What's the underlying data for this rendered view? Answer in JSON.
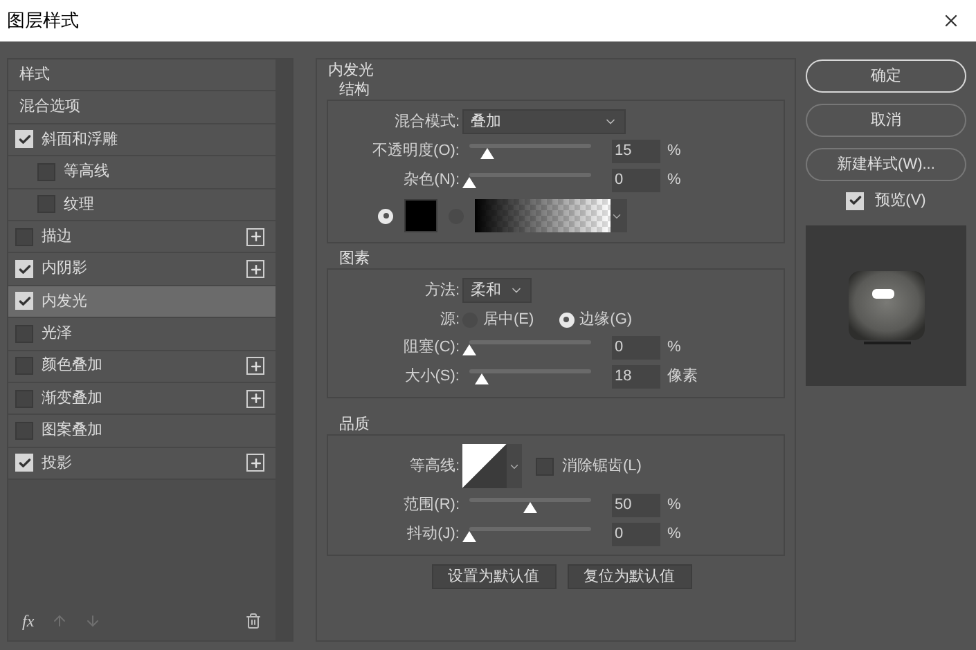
{
  "window": {
    "title": "图层样式"
  },
  "styles_panel": {
    "header": "样式",
    "items": [
      {
        "label": "混合选项",
        "kind": "plain",
        "selected": false
      },
      {
        "label": "斜面和浮雕",
        "kind": "check",
        "checked": true,
        "selected": false,
        "children": [
          {
            "label": "等高线",
            "kind": "check",
            "checked": false,
            "selected": false
          },
          {
            "label": "纹理",
            "kind": "check",
            "checked": false,
            "selected": false
          }
        ]
      },
      {
        "label": "描边",
        "kind": "check",
        "checked": false,
        "selected": false,
        "addable": true
      },
      {
        "label": "内阴影",
        "kind": "check",
        "checked": true,
        "selected": false,
        "addable": true
      },
      {
        "label": "内发光",
        "kind": "check",
        "checked": true,
        "selected": true
      },
      {
        "label": "光泽",
        "kind": "check",
        "checked": false,
        "selected": false
      },
      {
        "label": "颜色叠加",
        "kind": "check",
        "checked": false,
        "selected": false,
        "addable": true
      },
      {
        "label": "渐变叠加",
        "kind": "check",
        "checked": false,
        "selected": false,
        "addable": true
      },
      {
        "label": "图案叠加",
        "kind": "check",
        "checked": false,
        "selected": false
      },
      {
        "label": "投影",
        "kind": "check",
        "checked": true,
        "selected": false,
        "addable": true
      }
    ],
    "footer": {
      "fx": "fx"
    }
  },
  "settings": {
    "title": "内发光",
    "structure": {
      "title": "结构",
      "blend_mode": {
        "label": "混合模式:",
        "value": "叠加"
      },
      "sliders": [
        {
          "label": "不透明度(O):",
          "level": 0.15,
          "value": "15",
          "unit": "%"
        },
        {
          "label": "杂色(N):",
          "level": 0,
          "value": "0",
          "unit": "%"
        }
      ],
      "fill": [
        {
          "kind": "color",
          "selected": true,
          "color": "#000000"
        },
        {
          "kind": "gradient",
          "selected": false
        }
      ]
    },
    "elements": {
      "title": "图素",
      "method": {
        "label": "方法:",
        "value": "柔和"
      },
      "source": {
        "label": "源:",
        "options": [
          {
            "label": "居中(E)",
            "selected": false
          },
          {
            "label": "边缘(G)",
            "selected": true
          }
        ]
      },
      "sliders": [
        {
          "label": "阻塞(C):",
          "level": 0,
          "value": "0",
          "unit": "%"
        },
        {
          "label": "大小(S):",
          "level": 0.1,
          "value": "18",
          "unit": "像素"
        }
      ]
    },
    "quality": {
      "title": "品质",
      "contour": {
        "label": "等高线:"
      },
      "anti_alias": {
        "label": "消除锯齿(L)",
        "checked": false
      },
      "sliders": [
        {
          "label": "范围(R):",
          "level": 0.5,
          "value": "50",
          "unit": "%"
        },
        {
          "label": "抖动(J):",
          "level": 0,
          "value": "0",
          "unit": "%"
        }
      ]
    },
    "buttons": [
      "设置为默认值",
      "复位为默认值"
    ]
  },
  "actions": {
    "buttons": [
      {
        "label": "确定",
        "primary": true
      },
      {
        "label": "取消",
        "primary": false
      },
      {
        "label": "新建样式(W)...",
        "primary": false
      }
    ],
    "preview": {
      "label": "预览(V)",
      "checked": true
    }
  }
}
